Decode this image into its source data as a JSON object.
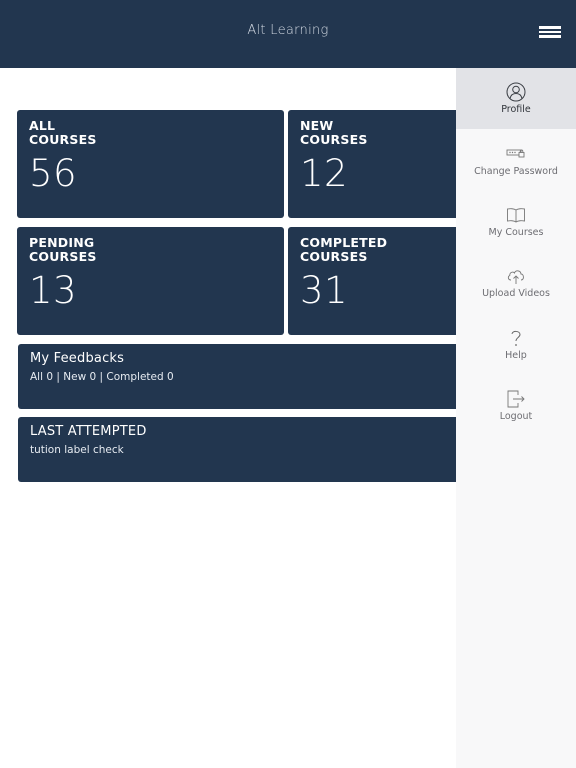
{
  "header": {
    "title": "Alt Learning",
    "menu_icon": "hamburger-menu-icon"
  },
  "stats": {
    "all": {
      "label_line1": "ALL",
      "label_line2": "COURSES",
      "value": "56"
    },
    "new": {
      "label_line1": "NEW",
      "label_line2": "COURSES",
      "value": "12"
    },
    "pending": {
      "label_line1": "PENDING",
      "label_line2": "COURSES",
      "value": "13"
    },
    "completed": {
      "label_line1": "COMPLETED",
      "label_line2": "COURSES",
      "value": "31"
    }
  },
  "feedbacks": {
    "title": "My Feedbacks",
    "summary": "All 0 | New 0 | Completed 0"
  },
  "last_attempted": {
    "title": "LAST ATTEMPTED",
    "course": "tution label check"
  },
  "sidebar": {
    "items": [
      {
        "label": "Profile",
        "icon": "profile-icon",
        "active": true
      },
      {
        "label": "Change Password",
        "icon": "password-icon",
        "active": false
      },
      {
        "label": "My Courses",
        "icon": "book-icon",
        "active": false
      },
      {
        "label": "Upload Videos",
        "icon": "cloud-upload-icon",
        "active": false
      },
      {
        "label": "Help",
        "icon": "help-icon",
        "active": false
      },
      {
        "label": "Logout",
        "icon": "logout-icon",
        "active": false
      }
    ]
  },
  "colors": {
    "primary": "#22364f",
    "sidebar_bg": "#f8f8f9",
    "sidebar_active": "#e2e3e7"
  }
}
